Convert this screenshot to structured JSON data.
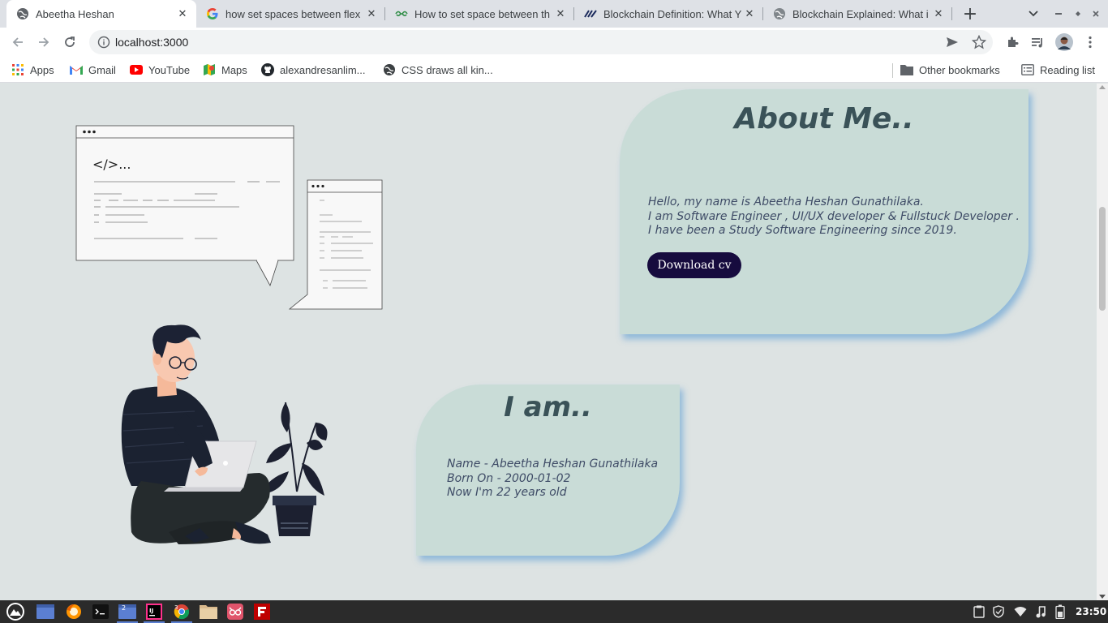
{
  "browser": {
    "tabs": [
      {
        "title": "Abeetha Heshan",
        "active": true,
        "favicon": "globe-icon"
      },
      {
        "title": "how set spaces between flex",
        "active": false,
        "favicon": "google-icon"
      },
      {
        "title": "How to set space between th",
        "active": false,
        "favicon": "geeksforgeeks-icon"
      },
      {
        "title": "Blockchain Definition: What Y",
        "active": false,
        "favicon": "investopedia-icon"
      },
      {
        "title": "Blockchain Explained: What i",
        "active": false,
        "favicon": "globe-icon"
      }
    ],
    "new_tab_label": "+",
    "url": "localhost:3000",
    "bookmarks": [
      {
        "label": "Apps",
        "icon": "apps-grid-icon"
      },
      {
        "label": "Gmail",
        "icon": "gmail-icon"
      },
      {
        "label": "YouTube",
        "icon": "youtube-icon"
      },
      {
        "label": "Maps",
        "icon": "maps-icon"
      },
      {
        "label": "alexandresanlim...",
        "icon": "github-icon"
      },
      {
        "label": "CSS draws all kin...",
        "icon": "globe-icon"
      }
    ],
    "other_bookmarks": "Other bookmarks",
    "reading_list": "Reading list"
  },
  "page": {
    "about": {
      "heading": "About Me..",
      "lines": [
        "Hello, my name is Abeetha Heshan Gunathilaka.",
        "I am Software Engineer , UI/UX developer & Fullstuck Developer .",
        "I have been a Study Software Engineering since 2019."
      ],
      "button": "Download cv"
    },
    "iam": {
      "heading": "I am..",
      "lines": [
        "Name - Abeetha Heshan Gunathilaka",
        "Born On - 2000-01-02",
        "Now I'm 22 years old"
      ]
    },
    "illustration": {
      "code_text": "</>..."
    }
  },
  "taskbar": {
    "workspace_badges": [
      "2",
      "3"
    ],
    "clock": "23:50"
  },
  "colors": {
    "page_bg": "#dde3e3",
    "card_bg": "#c9dcd7",
    "heading": "#3a5258",
    "body_text": "#3e4b66",
    "button_bg": "#160b3e"
  }
}
